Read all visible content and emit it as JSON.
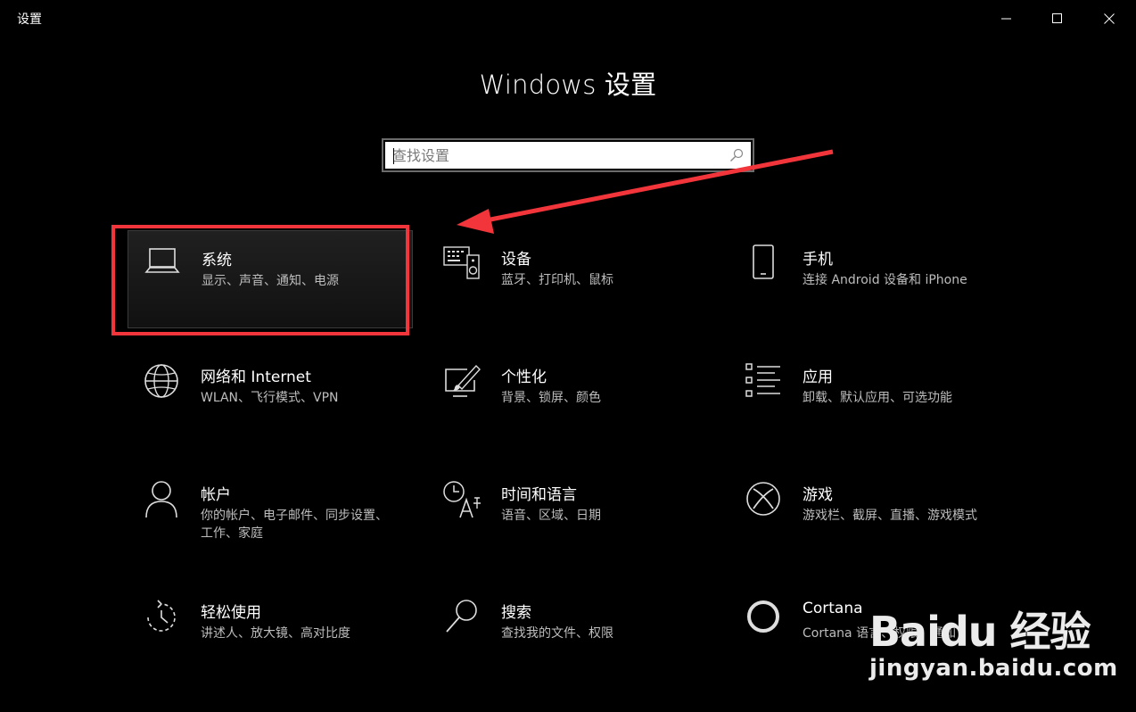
{
  "window": {
    "title": "设置"
  },
  "page": {
    "title": "Windows 设置"
  },
  "search": {
    "placeholder": "查找设置"
  },
  "tiles": [
    {
      "name": "系统",
      "desc": "显示、声音、通知、电源",
      "icon": "laptop-icon"
    },
    {
      "name": "设备",
      "desc": "蓝牙、打印机、鼠标",
      "icon": "keyboard-speaker-icon"
    },
    {
      "name": "手机",
      "desc": "连接 Android 设备和 iPhone",
      "icon": "phone-icon"
    },
    {
      "name": "网络和 Internet",
      "desc": "WLAN、飞行模式、VPN",
      "icon": "globe-icon"
    },
    {
      "name": "个性化",
      "desc": "背景、锁屏、颜色",
      "icon": "paint-tablet-icon"
    },
    {
      "name": "应用",
      "desc": "卸载、默认应用、可选功能",
      "icon": "app-list-icon"
    },
    {
      "name": "帐户",
      "desc": "你的帐户、电子邮件、同步设置、工作、家庭",
      "icon": "person-icon"
    },
    {
      "name": "时间和语言",
      "desc": "语音、区域、日期",
      "icon": "time-language-icon"
    },
    {
      "name": "游戏",
      "desc": "游戏栏、截屏、直播、游戏模式",
      "icon": "xbox-icon"
    },
    {
      "name": "轻松使用",
      "desc": "讲述人、放大镜、高对比度",
      "icon": "ease-of-access-icon"
    },
    {
      "name": "搜索",
      "desc": "查找我的文件、权限",
      "icon": "magnifier-icon"
    },
    {
      "name": "Cortana",
      "desc": "Cortana 语言、权限、通知",
      "icon": "cortana-ring-icon"
    }
  ],
  "watermark": {
    "brand": "Baidu 经验",
    "site": "jingyan.baidu.com"
  },
  "colors": {
    "background": "#000000",
    "highlight": "#f1353a",
    "text_secondary": "#bdbdbd"
  }
}
